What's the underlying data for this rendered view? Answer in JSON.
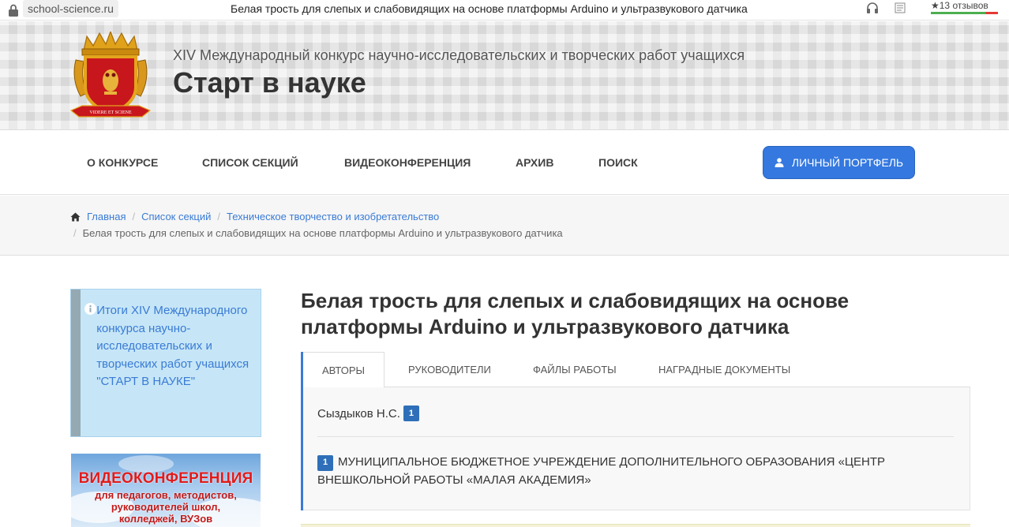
{
  "browser": {
    "url": "school-science.ru",
    "tab_title": "Белая трость для слепых и слабовидящих на основе платформы Arduino и ультразвукового датчика",
    "reviews": "★13 отзывов"
  },
  "header": {
    "subtitle": "XIV Международный конкурс научно-исследовательских и творческих работ учащихся",
    "title": "Старт в науке",
    "logo_motto": "VIDERE ET SCIENE"
  },
  "nav": {
    "items": [
      "О конкурсе",
      "Список секций",
      "Видеоконференция",
      "Архив",
      "Поиск"
    ],
    "portfolio_label": "Личный портфель"
  },
  "breadcrumb": {
    "home": "Главная",
    "sections": "Список секций",
    "category": "Техническое творчество и изобретательство",
    "current": "Белая трость для слепых и слабовидящих на основе платформы Arduino и ультразвукового датчика"
  },
  "sidebar": {
    "info_text": "Итоги XIV Международного конкурса научно-исследовательских и творческих работ учащихся \"СТАРТ В НАУКЕ\"",
    "banner_title": "ВИДЕОКОНФЕРЕНЦИЯ",
    "banner_lines": [
      "для педагогов, методистов,",
      "руководителей школ,",
      "колледжей, ВУЗов"
    ]
  },
  "work": {
    "title": "Белая трость для слепых и слабовидящих на основе платформы Arduino и ультразвукового датчика",
    "tabs": [
      "Авторы",
      "Руководители",
      "Файлы работы",
      "Наградные документы"
    ],
    "author_name": "Сыздыков Н.С.",
    "author_badge": "1",
    "org_badge": "1",
    "org_name": "Муниципальное бюджетное учреждение дополнительного образования «Центр внешкольной работы «Малая академия»"
  },
  "colors": {
    "accent": "#3a7bd5",
    "button": "#3478e0",
    "badge": "#2f6fb9",
    "banner_red": "#e11b1b"
  }
}
